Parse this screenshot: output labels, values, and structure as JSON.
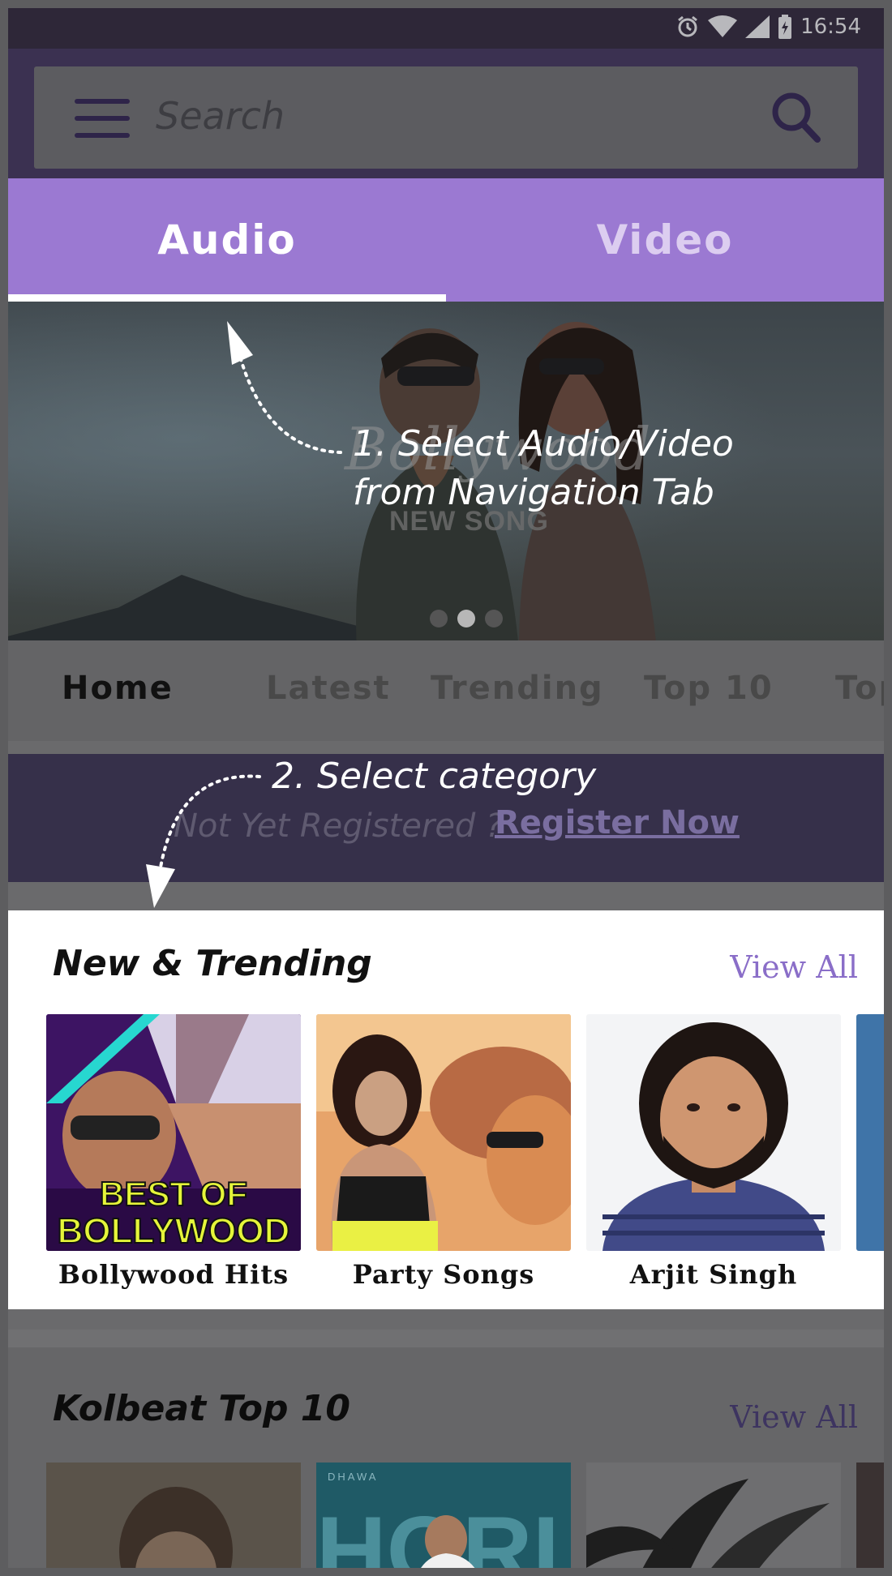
{
  "status_bar": {
    "time": "16:54"
  },
  "search": {
    "placeholder": "Search"
  },
  "tabs": [
    {
      "label": "Audio",
      "active": true
    },
    {
      "label": "Video",
      "active": false
    }
  ],
  "banner": {
    "title": "Bollywood",
    "subtitle": "NEW SONG",
    "slide_count": 3,
    "active_slide": 2
  },
  "annotations": {
    "step1": [
      "1. Select Audio/Video",
      "from Navigation Tab"
    ],
    "step2": "2. Select category"
  },
  "categories": [
    "Home",
    "Latest",
    "Trending",
    "Top 10",
    "Top"
  ],
  "active_category": "Home",
  "register": {
    "question": "Not Yet Registered ?",
    "link": "Register Now"
  },
  "new_trending": {
    "title": "New & Trending",
    "view_all": "View All",
    "items": [
      {
        "label": "Bollywood Hits",
        "art_text": [
          "BEST OF",
          "BOLLYWOOD"
        ]
      },
      {
        "label": "Party Songs"
      },
      {
        "label": "Arjit Singh"
      }
    ]
  },
  "kolbeat_top10": {
    "title": "Kolbeat Top 10",
    "view_all": "View All",
    "poster_text": [
      "DHAWA",
      "HORI"
    ]
  },
  "colors": {
    "accent": "#9b79d2",
    "header": "#3b3151",
    "status_bar": "#2e2738",
    "view_all": "#8a6ec8"
  }
}
